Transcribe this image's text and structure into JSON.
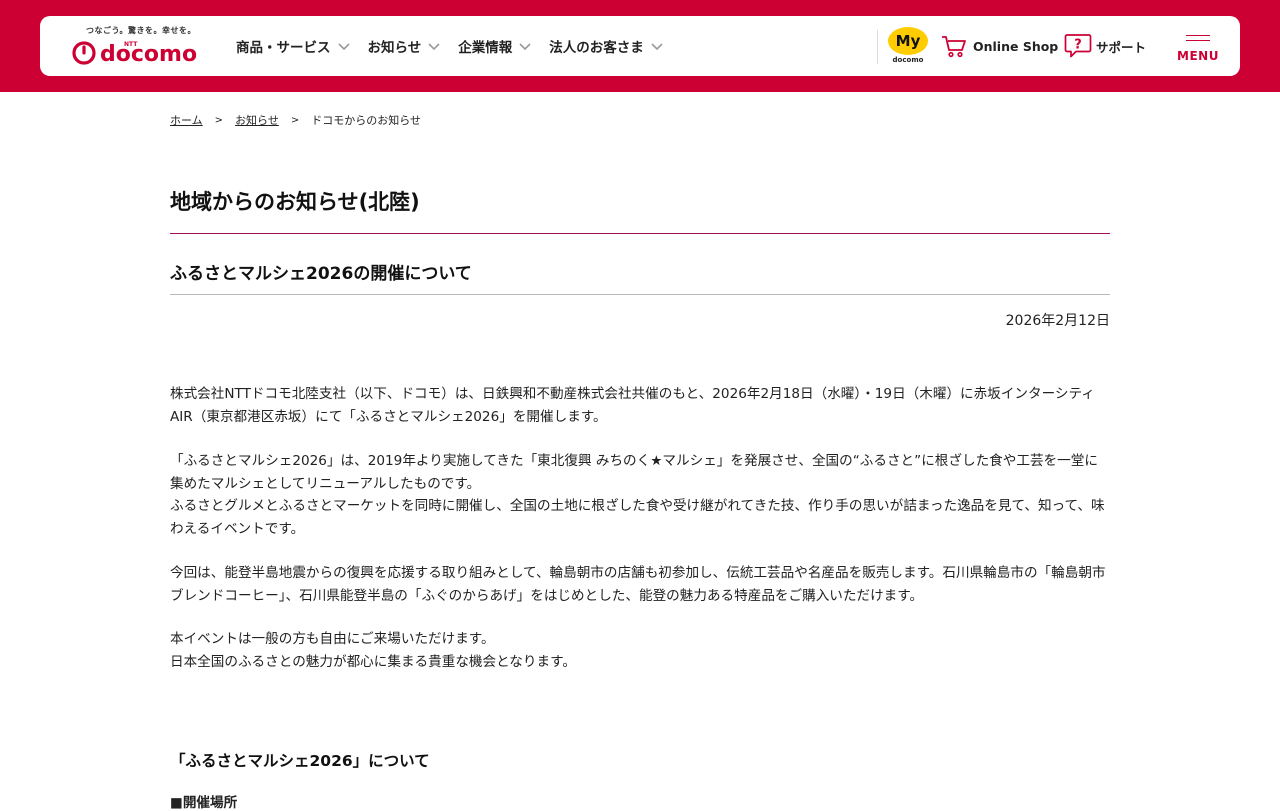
{
  "header": {
    "logo": {
      "tagline": "つなごう。驚きを。幸せを。",
      "ntt": "NTT",
      "wordmark": "docomo"
    },
    "nav": [
      {
        "label": "商品・サービス"
      },
      {
        "label": "お知らせ"
      },
      {
        "label": "企業情報"
      },
      {
        "label": "法人のお客さま"
      }
    ],
    "my_docomo": {
      "badge": "My",
      "sub": "docomo"
    },
    "online_shop": {
      "label": "Online Shop",
      "icon": "cart-icon"
    },
    "support": {
      "label": "サポート",
      "icon": "question-bubble-icon"
    },
    "menu": {
      "label": "MENU",
      "icon": "hamburger-icon"
    }
  },
  "breadcrumb": {
    "items": [
      "ホーム",
      "お知らせ",
      "ドコモからのお知らせ"
    ],
    "separator": ">"
  },
  "page": {
    "title": "地域からのお知らせ(北陸)",
    "article_title": "ふるさとマルシェ2026の開催について",
    "date": "2026年2月12日",
    "paragraphs": [
      [
        "株式会社NTTドコモ北陸支社（以下、ドコモ）は、日鉄興和不動産株式会社共催のもと、2026年2月18日（水曜）・19日（木曜）に赤坂インターシティAIR（東京都港区赤坂）にて「ふるさとマルシェ2026」を開催します。"
      ],
      [
        "「ふるさとマルシェ2026」は、2019年より実施してきた「東北復興 みちのく★マルシェ」を発展させ、全国の“ふるさと”に根ざした食や工芸を一堂に集めたマルシェとしてリニューアルしたものです。",
        "ふるさとグルメとふるさとマーケットを同時に開催し、全国の土地に根ざした食や受け継がれてきた技、作り手の思いが詰まった逸品を見て、知って、味わえるイベントです。"
      ],
      [
        "今回は、能登半島地震からの復興を応援する取り組みとして、輪島朝市の店舗も初参加し、伝統工芸品や名産品を販売します。石川県輪島市の「輪島朝市ブレンドコーヒー」、石川県能登半島の「ふぐのからあげ」をはじめとした、能登の魅力ある特産品をご購入いただけます。"
      ],
      [
        "本イベントは一般の方も自由にご来場いただけます。",
        "日本全国のふるさとの魅力が都心に集まる貴重な機会となります。"
      ]
    ],
    "section_title": "「ふるさとマルシェ2026」について",
    "venue_label": "■開催場所"
  },
  "colors": {
    "brand_red": "#cc0033",
    "accent_rule": "#a0115a",
    "my_docomo_yellow": "#ffcc00"
  }
}
